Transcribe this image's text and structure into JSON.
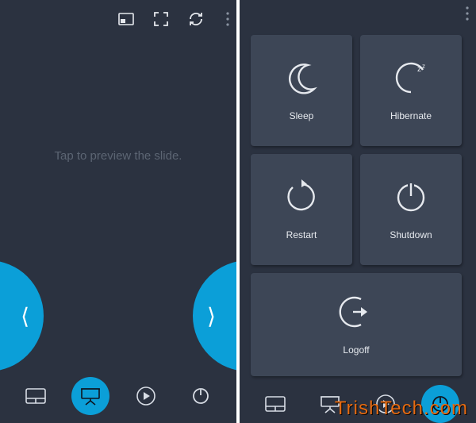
{
  "left": {
    "preview_hint": "Tap to preview the slide."
  },
  "tiles": {
    "sleep": "Sleep",
    "hibernate": "Hibernate",
    "restart": "Restart",
    "shutdown": "Shutdown",
    "logoff": "Logoff"
  },
  "watermark": "TrishTech.com",
  "colors": {
    "bg": "#2b3240",
    "tile": "#3d4656",
    "accent": "#0b9fd8",
    "muted": "#5c6573"
  }
}
